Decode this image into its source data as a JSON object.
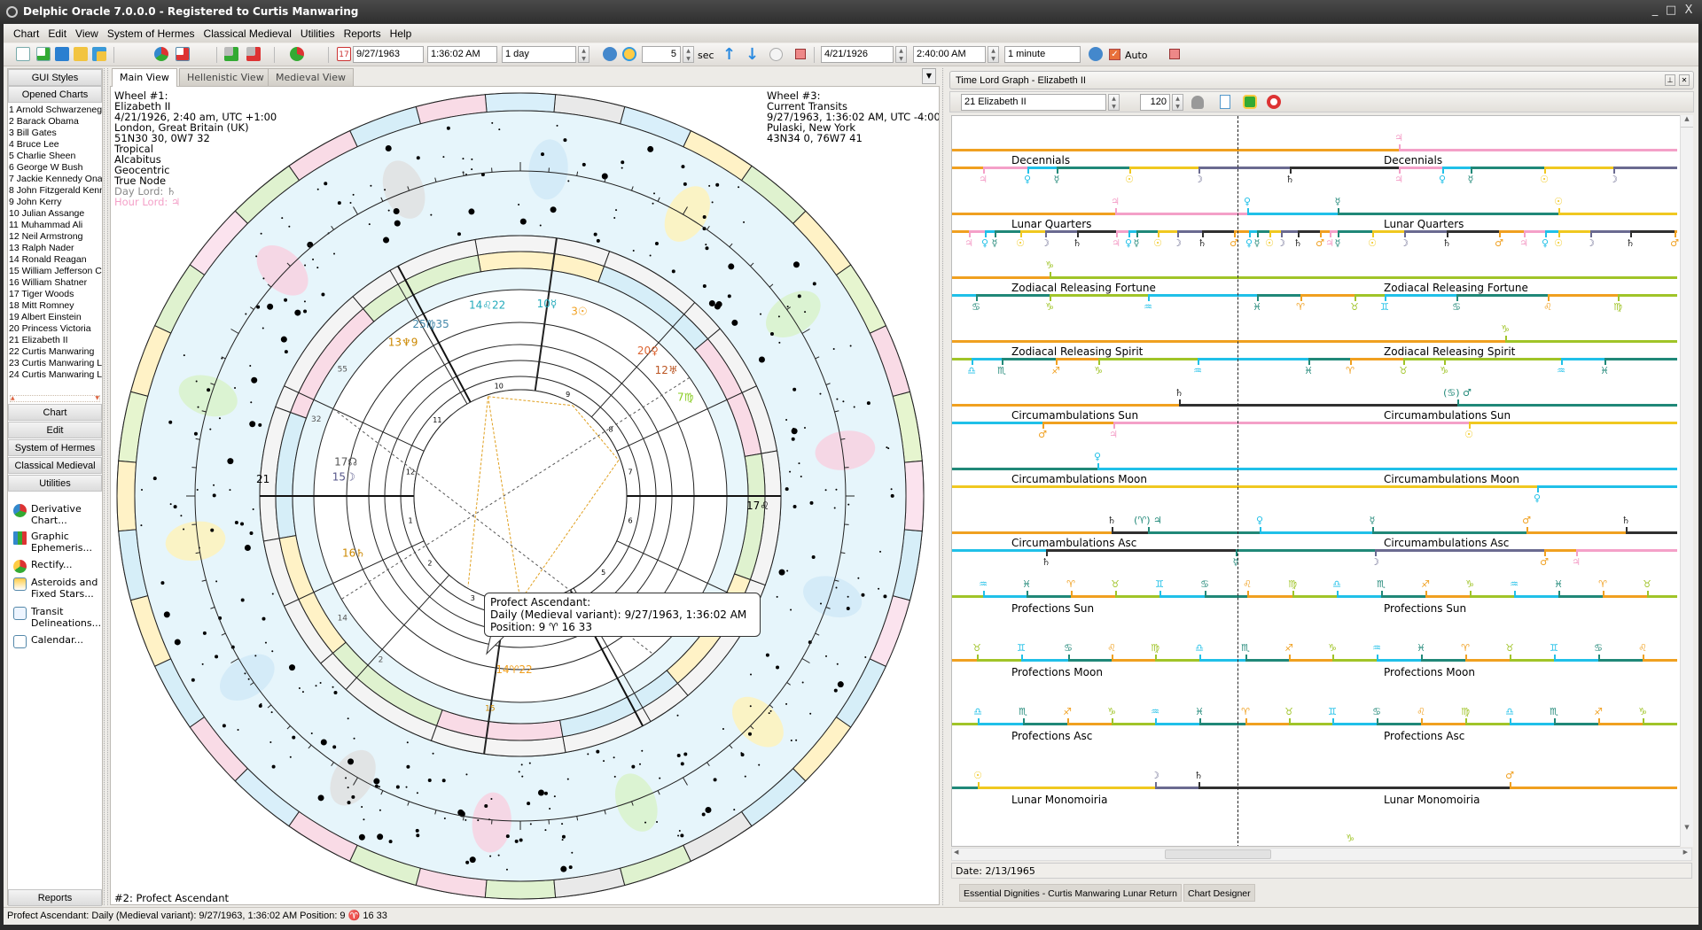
{
  "window": {
    "title": "Delphic Oracle 7.0.0.0 -  Registered to Curtis Manwaring",
    "controls": [
      "_",
      "□",
      "X"
    ]
  },
  "menu": [
    "Chart",
    "Edit",
    "View",
    "System of Hermes",
    "Classical Medieval",
    "Utilities",
    "Reports",
    "Help"
  ],
  "toolbar": {
    "date1": "9/27/1963",
    "time1": "1:36:02 AM",
    "step1": "1 day",
    "interval": "5",
    "interval_unit": "sec",
    "date2": "4/21/1926",
    "time2": "2:40:00 AM",
    "step2": "1 minute",
    "auto_label": "Auto",
    "auto_checked": true,
    "calendar_icon_text": "17"
  },
  "sidebar": {
    "gui_styles": "GUI Styles",
    "opened_charts": "Opened Charts",
    "charts": [
      "1 Arnold Schwarzenegger",
      "2 Barack Obama",
      "3 Bill Gates",
      "4 Bruce Lee",
      "5 Charlie Sheen",
      "6 George W Bush",
      "7 Jackie Kennedy Onassis",
      "8 John Fitzgerald Kennedy",
      "9 John Kerry",
      "10 Julian Assange",
      "11 Muhammad Ali",
      "12 Neil Armstrong",
      "13 Ralph Nader",
      "14 Ronald Reagan",
      "15 William Jefferson Clinton",
      "16 William Shatner",
      "17 Tiger Woods",
      "18 Mitt Romney",
      "19 Albert Einstein",
      "20 Princess Victoria",
      "21 Elizabeth II",
      "22 Curtis Manwaring",
      "23 Curtis Manwaring L",
      "24 Curtis Manwaring L"
    ],
    "sections": [
      "Chart",
      "Edit",
      "System of Hermes",
      "Classical Medieval",
      "Utilities"
    ],
    "utilities": [
      {
        "label": "Derivative\nChart...",
        "icon": "pie-chart-icon"
      },
      {
        "label": "Graphic\nEphemeris...",
        "icon": "bar-chart-icon"
      },
      {
        "label": "Rectify...",
        "icon": "rectify-pie-icon"
      },
      {
        "label": "Asteroids and\nFixed Stars...",
        "icon": "star-document-icon"
      },
      {
        "label": "Transit\nDelineations...",
        "icon": "document-icon"
      },
      {
        "label": "Calendar...",
        "icon": "calendar-icon"
      }
    ],
    "reports": "Reports"
  },
  "main": {
    "tabs": [
      "Main View",
      "Hellenistic View",
      "Medieval View"
    ],
    "wheel1": {
      "lines": [
        "Wheel #1:",
        "Elizabeth II",
        "4/21/1926, 2:40 am, UTC +1:00",
        "London, Great Britain (UK)",
        "51N30 30, 0W7 32",
        "Tropical",
        "Alcabitus",
        "Geocentric",
        "True Node"
      ],
      "day_lord": "Day Lord: ♄",
      "hour_lord": "Hour Lord: ♃"
    },
    "wheel3": {
      "lines": [
        "Wheel #3:",
        "Current Transits",
        "9/27/1963, 1:36:02 AM, UTC -4:00",
        "Pulaski, New York",
        "43N34 0, 76W7 41"
      ]
    },
    "bottom_label": "#2: Profect Ascendant",
    "tooltip": [
      "Profect Ascendant:",
      "Daily (Medieval variant): 9/27/1963, 1:36:02 AM",
      "Position: 9 ♈ 16 33"
    ],
    "wheel_labels": {
      "left_cusp": "21",
      "right_cusp": "17♌",
      "planets": [
        "14♌22",
        "25♍35",
        "13♆9",
        "10☿",
        "3☉",
        "20♀",
        "12♅",
        "7♍",
        "15☽",
        "17☊",
        "16♄",
        "14♈22",
        "15",
        "2",
        "14",
        "32",
        "55"
      ],
      "houses": [
        "1",
        "2",
        "3",
        "4",
        "5",
        "6",
        "7",
        "8",
        "9",
        "10",
        "11",
        "12"
      ]
    },
    "sign_band_colors": [
      "#f9dbe6",
      "#dff2cf",
      "#e9e9e9",
      "#d6eef8",
      "#fbe3ee",
      "#e6f5cf",
      "#fff2c6",
      "#d9effa",
      "#f9dbe6",
      "#dff2cf",
      "#fff2c6",
      "#d6eef8"
    ],
    "starfield_color": "#e6f5fb"
  },
  "timelord": {
    "title": "Time Lord Graph - Elizabeth II",
    "chart_select": "21 Elizabeth II",
    "count": "120",
    "date": "Date: 2/13/1965",
    "colors": {
      "orange": "#f0a020",
      "pink": "#f4a0c8",
      "cyan": "#20c0e8",
      "teal": "#208878",
      "yellow": "#f0c820",
      "slate": "#6a6a90",
      "black": "#303030",
      "green": "#a0c428"
    },
    "rows": [
      {
        "label": "Decennials",
        "top": [
          [
            "♂",
            "orange"
          ],
          [
            "♃",
            "pink"
          ]
        ],
        "bottom": [
          [
            "♂",
            "orange"
          ],
          [
            "♃",
            "pink"
          ],
          [
            "♀",
            "cyan"
          ],
          [
            "☿",
            "teal"
          ],
          [
            "☉",
            "yellow"
          ],
          [
            "☽",
            "slate"
          ],
          [
            "♄",
            "black"
          ],
          [
            "♃",
            "pink"
          ],
          [
            "♀",
            "cyan"
          ],
          [
            "☿",
            "teal"
          ],
          [
            "☉",
            "yellow"
          ],
          [
            "☽",
            "slate"
          ]
        ]
      },
      {
        "label": "Lunar Quarters",
        "top": [
          [
            "♂",
            "orange"
          ],
          [
            "♃",
            "pink"
          ],
          [
            "♀",
            "cyan"
          ],
          [
            "☿",
            "teal"
          ],
          [
            "☉",
            "yellow"
          ]
        ],
        "bottom": [
          [
            "♂",
            "orange"
          ],
          [
            "♃",
            "pink"
          ],
          [
            "♀",
            "cyan"
          ],
          [
            "☿",
            "teal"
          ],
          [
            "☉",
            "yellow"
          ],
          [
            "☽",
            "slate"
          ],
          [
            "♄",
            "black"
          ],
          [
            "♃",
            "pink"
          ],
          [
            "♀",
            "cyan"
          ],
          [
            "☿",
            "teal"
          ],
          [
            "☉",
            "yellow"
          ],
          [
            "☽",
            "slate"
          ],
          [
            "♄",
            "black"
          ],
          [
            "♂",
            "orange"
          ],
          [
            "♀",
            "cyan"
          ],
          [
            "☿",
            "teal"
          ],
          [
            "☉",
            "yellow"
          ],
          [
            "☽",
            "slate"
          ],
          [
            "♄",
            "black"
          ],
          [
            "♂",
            "orange"
          ],
          [
            "♃",
            "pink"
          ],
          [
            "☿",
            "teal"
          ],
          [
            "☉",
            "yellow"
          ],
          [
            "☽",
            "slate"
          ],
          [
            "♄",
            "black"
          ],
          [
            "♂",
            "orange"
          ],
          [
            "♃",
            "pink"
          ],
          [
            "♀",
            "cyan"
          ],
          [
            "☉",
            "yellow"
          ],
          [
            "☽",
            "slate"
          ],
          [
            "♄",
            "black"
          ],
          [
            "♂",
            "orange"
          ]
        ]
      },
      {
        "label": "Zodiacal Releasing Fortune",
        "top": [
          [
            "♌",
            "orange"
          ],
          [
            "♑",
            "green"
          ]
        ],
        "bottom": [
          [
            "♒",
            "cyan"
          ],
          [
            "♋",
            "teal"
          ],
          [
            "♑",
            "green"
          ],
          [
            "♒",
            "cyan"
          ],
          [
            "♓",
            "teal"
          ],
          [
            "♈",
            "orange"
          ],
          [
            "♉",
            "green"
          ],
          [
            "♊",
            "cyan"
          ],
          [
            "♋",
            "teal"
          ],
          [
            "♌",
            "orange"
          ],
          [
            "♍",
            "green"
          ]
        ]
      },
      {
        "label": "Zodiacal Releasing Spirit",
        "top": [
          [
            "♌",
            "orange"
          ],
          [
            "♑",
            "green"
          ]
        ],
        "bottom": [
          [
            "♍",
            "green"
          ],
          [
            "♎",
            "cyan"
          ],
          [
            "♏",
            "teal"
          ],
          [
            "♐",
            "orange"
          ],
          [
            "♑",
            "green"
          ],
          [
            "♒",
            "cyan"
          ],
          [
            "♓",
            "teal"
          ],
          [
            "♈",
            "orange"
          ],
          [
            "♉",
            "green"
          ],
          [
            "♑",
            "green"
          ],
          [
            "♒",
            "cyan"
          ],
          [
            "♓",
            "teal"
          ]
        ]
      },
      {
        "label": "Circumambulations Sun",
        "top": [
          [
            "♂",
            "orange"
          ],
          [
            "♄",
            "black"
          ],
          [
            "(♋) ♂",
            "teal"
          ]
        ],
        "bottom": [
          [
            "♀",
            "cyan"
          ],
          [
            "♂",
            "orange"
          ],
          [
            "♃",
            "pink"
          ],
          [
            "☉",
            "yellow"
          ]
        ]
      },
      {
        "label": "Circumambulations Moon",
        "top": [
          [
            "☿",
            "teal"
          ],
          [
            "♀",
            "cyan"
          ]
        ],
        "bottom": [
          [
            "☉",
            "yellow"
          ],
          [
            "♀",
            "cyan"
          ]
        ]
      },
      {
        "label": "Circumambulations Asc",
        "top": [
          [
            "♂",
            "orange"
          ],
          [
            "♄",
            "black"
          ],
          [
            "(♈) ♃",
            "teal"
          ],
          [
            "♀",
            "cyan"
          ],
          [
            "☿",
            "teal"
          ],
          [
            "♂",
            "orange"
          ],
          [
            "♄",
            "black"
          ]
        ],
        "bottom": [
          [
            "♀",
            "cyan"
          ],
          [
            "♄",
            "black"
          ],
          [
            "☿",
            "teal"
          ],
          [
            "☽",
            "slate"
          ],
          [
            "♂",
            "orange"
          ],
          [
            "♃",
            "pink"
          ]
        ]
      },
      {
        "label": "Profections Sun",
        "top": [
          [
            "♑",
            "green"
          ],
          [
            "♒",
            "cyan"
          ],
          [
            "♓",
            "teal"
          ],
          [
            "♈",
            "orange"
          ],
          [
            "♉",
            "green"
          ],
          [
            "♊",
            "cyan"
          ],
          [
            "♋",
            "teal"
          ],
          [
            "♌",
            "orange"
          ],
          [
            "♍",
            "green"
          ],
          [
            "♎",
            "cyan"
          ],
          [
            "♏",
            "teal"
          ],
          [
            "♐",
            "orange"
          ],
          [
            "♑",
            "green"
          ],
          [
            "♒",
            "cyan"
          ],
          [
            "♓",
            "teal"
          ],
          [
            "♈",
            "orange"
          ],
          [
            "♉",
            "green"
          ]
        ]
      },
      {
        "label": "Profections Moon",
        "top": [
          [
            "♈",
            "orange"
          ],
          [
            "♉",
            "green"
          ],
          [
            "♊",
            "cyan"
          ],
          [
            "♋",
            "teal"
          ],
          [
            "♌",
            "orange"
          ],
          [
            "♍",
            "green"
          ],
          [
            "♎",
            "cyan"
          ],
          [
            "♏",
            "teal"
          ],
          [
            "♐",
            "orange"
          ],
          [
            "♑",
            "green"
          ],
          [
            "♒",
            "cyan"
          ],
          [
            "♓",
            "teal"
          ],
          [
            "♈",
            "orange"
          ],
          [
            "♉",
            "green"
          ],
          [
            "♊",
            "cyan"
          ],
          [
            "♋",
            "teal"
          ],
          [
            "♌",
            "orange"
          ]
        ]
      },
      {
        "label": "Profections Asc",
        "top": [
          [
            "♍",
            "green"
          ],
          [
            "♎",
            "cyan"
          ],
          [
            "♏",
            "teal"
          ],
          [
            "♐",
            "orange"
          ],
          [
            "♑",
            "green"
          ],
          [
            "♒",
            "cyan"
          ],
          [
            "♓",
            "teal"
          ],
          [
            "♈",
            "orange"
          ],
          [
            "♉",
            "green"
          ],
          [
            "♊",
            "cyan"
          ],
          [
            "♋",
            "teal"
          ],
          [
            "♌",
            "orange"
          ],
          [
            "♍",
            "green"
          ],
          [
            "♎",
            "cyan"
          ],
          [
            "♏",
            "teal"
          ],
          [
            "♐",
            "orange"
          ],
          [
            "♑",
            "green"
          ]
        ]
      },
      {
        "label": "Lunar Monomoiria",
        "top": [
          [
            "☿",
            "teal"
          ],
          [
            "☉",
            "yellow"
          ],
          [
            "☽",
            "slate"
          ],
          [
            "♄",
            "black"
          ],
          [
            "♂",
            "orange"
          ]
        ]
      }
    ],
    "trailing_glyph": [
      "♑",
      "green"
    ],
    "bottom_tabs": [
      "Essential Dignities - Curtis Manwaring Lunar Return",
      "Chart Designer"
    ]
  },
  "statusbar": "Profect Ascendant: Daily (Medieval variant): 9/27/1963, 1:36:02 AM Position: 9 ♈ 16 33"
}
